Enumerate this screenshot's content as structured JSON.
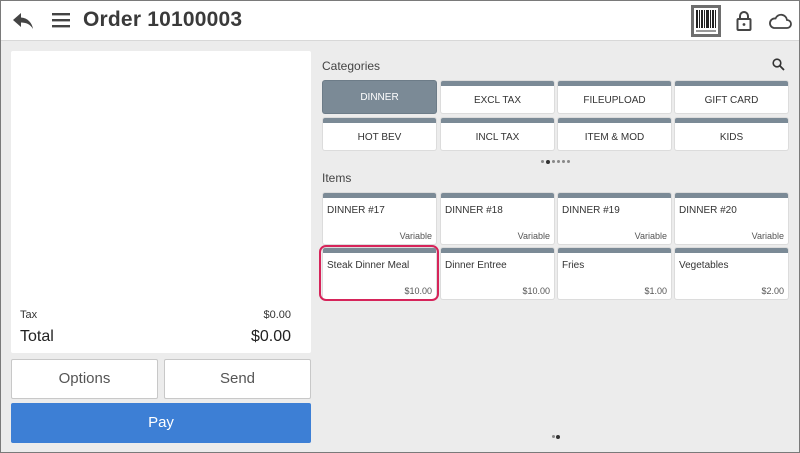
{
  "header": {
    "title": "Order 10100003",
    "icons": [
      "back-arrow-icon",
      "hamburger-menu-icon",
      "barcode-icon",
      "lock-icon",
      "cloud-icon"
    ]
  },
  "order": {
    "tax_label": "Tax",
    "tax_value": "$0.00",
    "total_label": "Total",
    "total_value": "$0.00",
    "options_label": "Options",
    "send_label": "Send",
    "pay_label": "Pay"
  },
  "categories": {
    "label": "Categories",
    "selected": "DINNER",
    "items": [
      {
        "label": "DINNER"
      },
      {
        "label": "EXCL TAX"
      },
      {
        "label": "FILEUPLOAD"
      },
      {
        "label": "GIFT CARD"
      },
      {
        "label": "HOT BEV"
      },
      {
        "label": "INCL TAX"
      },
      {
        "label": "ITEM & MOD"
      },
      {
        "label": "KIDS"
      }
    ]
  },
  "items": {
    "label": "Items",
    "list": [
      {
        "name": "DINNER #17",
        "price": "Variable"
      },
      {
        "name": "DINNER #18",
        "price": "Variable"
      },
      {
        "name": "DINNER #19",
        "price": "Variable"
      },
      {
        "name": "DINNER #20",
        "price": "Variable"
      },
      {
        "name": "Steak Dinner Meal",
        "price": "$10.00"
      },
      {
        "name": "Dinner Entree",
        "price": "$10.00"
      },
      {
        "name": "Fries",
        "price": "$1.00"
      },
      {
        "name": "Vegetables",
        "price": "$2.00"
      }
    ]
  },
  "colors": {
    "pay_button": "#3d7fd5",
    "tile_bar": "#7b8a96",
    "highlight": "#d6245a",
    "background": "#ececec"
  }
}
